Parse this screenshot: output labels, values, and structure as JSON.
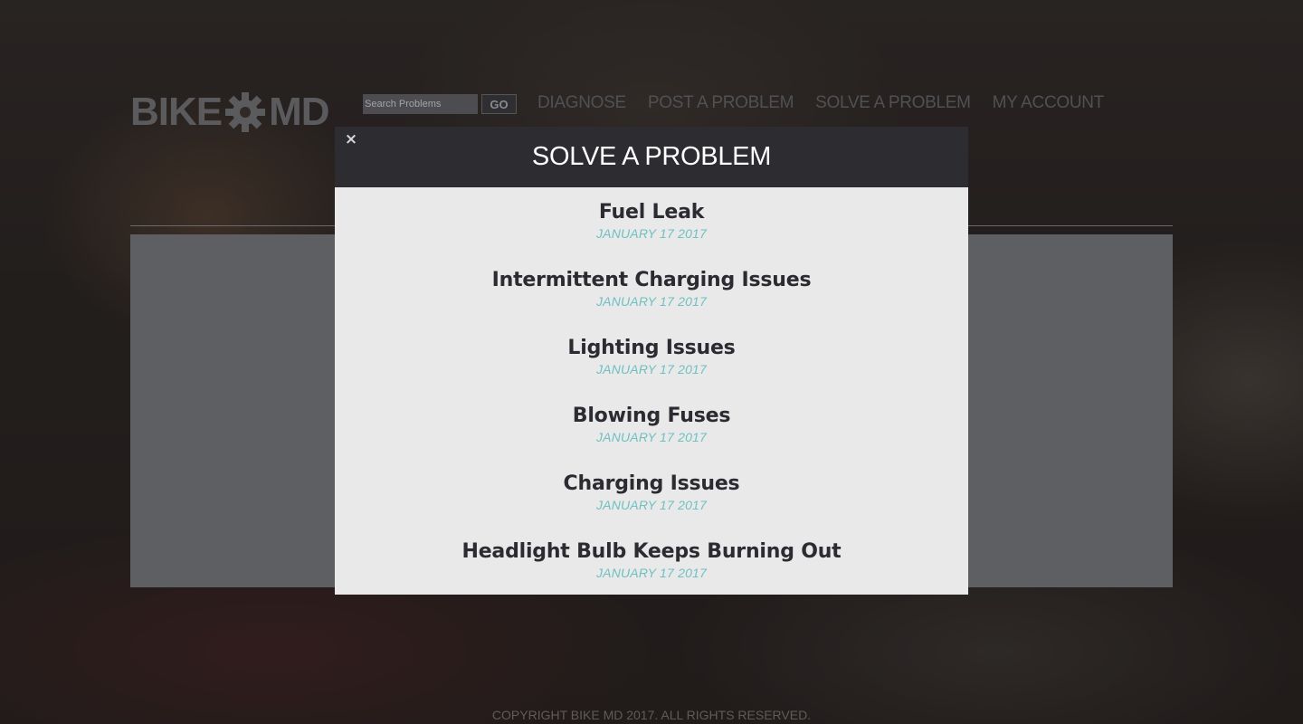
{
  "header": {
    "logo_left": "BIKE",
    "logo_right": "MD",
    "search_placeholder": "Search Problems",
    "go_label": "GO",
    "nav": [
      "DIAGNOSE",
      "POST A PROBLEM",
      "SOLVE A PROBLEM",
      "MY ACCOUNT"
    ]
  },
  "modal": {
    "close_label": "×",
    "title": "SOLVE A PROBLEM",
    "problems": [
      {
        "title": "Fuel Leak",
        "date": "JANUARY 17 2017"
      },
      {
        "title": "Intermittent Charging Issues",
        "date": "JANUARY 17 2017"
      },
      {
        "title": "Lighting Issues",
        "date": "JANUARY 17 2017"
      },
      {
        "title": "Blowing Fuses",
        "date": "JANUARY 17 2017"
      },
      {
        "title": "Charging Issues",
        "date": "JANUARY 17 2017"
      },
      {
        "title": "Headlight Bulb Keeps Burning Out",
        "date": "JANUARY 17 2017"
      }
    ]
  },
  "footer": {
    "copyright": "COPYRIGHT BIKE MD 2017. ALL RIGHTS RESERVED."
  },
  "colors": {
    "modal_header": "#2c2c31",
    "modal_body": "#e9e9e9",
    "date_accent": "#6fc0c2",
    "problem_title": "#2b2b31"
  },
  "icons": {
    "logo_gear": "gear-icon",
    "close": "close-icon"
  }
}
